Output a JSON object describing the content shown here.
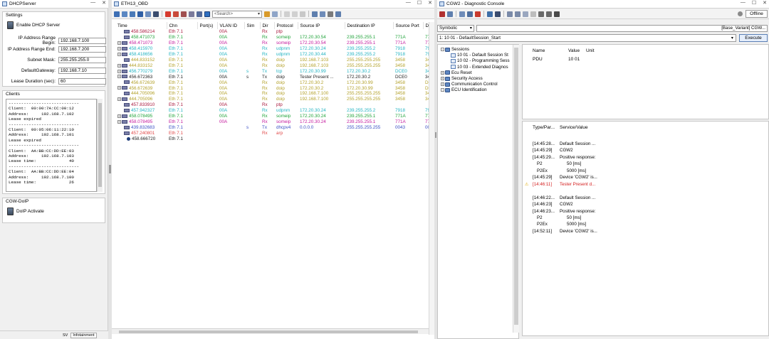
{
  "dhcp": {
    "title": "DHCPServer",
    "settings_label": "Settings",
    "enable_label": "Enable DHCP Server",
    "fields": [
      {
        "label": "IP Address Range Begin:",
        "value": "192.168.7.100"
      },
      {
        "label": "IP Address Range End:",
        "value": "192.168.7.200"
      },
      {
        "label": "Subnet Mask:",
        "value": "255.255.255.0"
      },
      {
        "label": "DefaultGateway:",
        "value": "192.168.7.10"
      },
      {
        "label": "Lease Duration (sec):",
        "value": "60"
      }
    ],
    "clients_label": "Clients",
    "clients_log": "----------------------------\nClient:  00:00:7A:CC:00:12\nAddress:     192.168.7.102\nLease expired\n----------------------------\nClient:  00:05:06:11:22:10\nAddress:     192.168.7.101\nLease expired\n----------------------------\nClient:  AA:BB:CC:DD:EE:03\nAddress:     192.168.7.103\nLease time:             40\n----------------------------\nClient:  AA:BB:CC:DD:EE:04\nAddress:     192.168.7.100\nLease time:             26",
    "doip_label": "CGW-DoIP",
    "doip_activate": "DoIP Activate",
    "bottom_tabs": [
      "SV",
      "Infotainment"
    ]
  },
  "trace": {
    "title": "ETH13_OBD",
    "search_placeholder": "<Search>",
    "columns": [
      "Time",
      "Chn",
      "Port(s)",
      "VLAN ID",
      "Sim",
      "Dir",
      "Protocol",
      "Source IP",
      "Destination IP",
      "Source Port",
      "Destination"
    ],
    "rows": [
      {
        "exp": "",
        "time": "458.586214",
        "chn": "Eth 7.1",
        "port": "",
        "vlan": "00A",
        "sim": "",
        "dir": "Rx",
        "proto": "ptp",
        "src": "",
        "dst": "",
        "sport": "",
        "dport": "",
        "color": "#a8183c"
      },
      {
        "exp": "",
        "time": "458.471073",
        "chn": "Eth 7.1",
        "port": "",
        "vlan": "00A",
        "sim": "",
        "dir": "Rx",
        "proto": "someip",
        "src": "172.20.30.54",
        "dst": "239.255.255.1",
        "sport": "771A",
        "dport": "771A",
        "color": "#20a33a"
      },
      {
        "exp": "+",
        "time": "458.471073",
        "chn": "Eth 7.1",
        "port": "",
        "vlan": "00A",
        "sim": "",
        "dir": "Rx",
        "proto": "someip",
        "src": "172.20.30.54",
        "dst": "239.255.255.1",
        "sport": "771A",
        "dport": "771A",
        "color": "#c41a9e"
      },
      {
        "exp": "+",
        "time": "458.415970",
        "chn": "Eth 7.1",
        "port": "",
        "vlan": "00A",
        "sim": "",
        "dir": "Rx",
        "proto": "udpnm",
        "src": "172.20.30.24",
        "dst": "239.255.255.2",
        "sport": "7918",
        "dport": "7918",
        "color": "#22b3c2"
      },
      {
        "exp": "+",
        "time": "458.418656",
        "chn": "Eth 7.1",
        "port": "",
        "vlan": "00A",
        "sim": "",
        "dir": "Rx",
        "proto": "udpnm",
        "src": "172.20.30.44",
        "dst": "239.255.255.2",
        "sport": "7918",
        "dport": "7918",
        "color": "#22b3c2"
      },
      {
        "exp": "",
        "time": "444.833152",
        "chn": "Eth 7.1",
        "port": "",
        "vlan": "00A",
        "sim": "",
        "dir": "Rx",
        "proto": "doip",
        "src": "192.168.7.103",
        "dst": "255.255.255.255",
        "sport": "3458",
        "dport": "3458",
        "color": "#b3a12a"
      },
      {
        "exp": "+",
        "time": "444.833152",
        "chn": "Eth 7.1",
        "port": "",
        "vlan": "00A",
        "sim": "",
        "dir": "Rx",
        "proto": "doip",
        "src": "192.168.7.103",
        "dst": "255.255.255.255",
        "sport": "3458",
        "dport": "3458",
        "color": "#b3a12a"
      },
      {
        "exp": "+",
        "time": "456.770279",
        "chn": "Eth 7.1",
        "port": "",
        "vlan": "00A",
        "sim": "s",
        "dir": "Tx",
        "proto": "tcp",
        "src": "172.20.30.99",
        "dst": "172.20.30.2",
        "sport": "DCE0",
        "dport": "3458",
        "color": "#22b3c2"
      },
      {
        "exp": "+",
        "time": "456.672363",
        "chn": "Eth 7.1",
        "port": "",
        "vlan": "00A",
        "sim": "s",
        "dir": "Tx",
        "proto": "doip",
        "src": "Tester Present ...",
        "dst": "172.20.30.2",
        "sport": "DCE0",
        "dport": "3458",
        "color": "#222222"
      },
      {
        "exp": "",
        "time": "456.672639",
        "chn": "Eth 7.1",
        "port": "",
        "vlan": "00A",
        "sim": "",
        "dir": "Rx",
        "proto": "doip",
        "src": "172.20.30.2",
        "dst": "172.20.30.99",
        "sport": "3458",
        "dport": "DCE0",
        "color": "#b3a12a"
      },
      {
        "exp": "+",
        "time": "456.672639",
        "chn": "Eth 7.1",
        "port": "",
        "vlan": "00A",
        "sim": "",
        "dir": "Rx",
        "proto": "doip",
        "src": "172.20.30.2",
        "dst": "172.20.30.99",
        "sport": "3458",
        "dport": "DCE0",
        "color": "#b3a12a"
      },
      {
        "exp": "",
        "time": "444.705096",
        "chn": "Eth 7.1",
        "port": "",
        "vlan": "00A",
        "sim": "",
        "dir": "Rx",
        "proto": "doip",
        "src": "192.168.7.100",
        "dst": "255.255.255.255",
        "sport": "3458",
        "dport": "3458",
        "color": "#b3a12a"
      },
      {
        "exp": "+",
        "time": "444.705096",
        "chn": "Eth 7.1",
        "port": "",
        "vlan": "00A",
        "sim": "",
        "dir": "Rx",
        "proto": "doip",
        "src": "192.168.7.100",
        "dst": "255.255.255.255",
        "sport": "3458",
        "dport": "3458",
        "color": "#b3a12a"
      },
      {
        "exp": "",
        "time": "457.833910",
        "chn": "Eth 7.1",
        "port": "",
        "vlan": "00A",
        "sim": "",
        "dir": "Rx",
        "proto": "ptp",
        "src": "",
        "dst": "",
        "sport": "",
        "dport": "",
        "color": "#a8183c"
      },
      {
        "exp": "",
        "time": "457.942327",
        "chn": "Eth 7.1",
        "port": "",
        "vlan": "00A",
        "sim": "",
        "dir": "Rx",
        "proto": "udpnm",
        "src": "172.20.30.24",
        "dst": "239.255.255.2",
        "sport": "7918",
        "dport": "7918",
        "color": "#22b3c2"
      },
      {
        "exp": "+",
        "time": "458.078495",
        "chn": "Eth 7.1",
        "port": "",
        "vlan": "00A",
        "sim": "",
        "dir": "Rx",
        "proto": "someip",
        "src": "172.20.30.24",
        "dst": "239.255.255.1",
        "sport": "771A",
        "dport": "771A",
        "color": "#20a33a"
      },
      {
        "exp": "+",
        "time": "458.078495",
        "chn": "Eth 7.1",
        "port": "",
        "vlan": "00A",
        "sim": "",
        "dir": "Rx",
        "proto": "someip",
        "src": "172.20.30.24",
        "dst": "239.255.255.1",
        "sport": "771A",
        "dport": "771A",
        "color": "#c41a9e"
      },
      {
        "exp": "",
        "time": "439.832683",
        "chn": "Eth 7.1",
        "port": "",
        "vlan": "",
        "sim": "s",
        "dir": "Tx",
        "proto": "dhcpv4",
        "src": "0.0.0.0",
        "dst": "255.255.255.255",
        "sport": "0043",
        "dport": "0044",
        "color": "#3b4fc4"
      },
      {
        "exp": "",
        "time": "457.240801",
        "chn": "Eth 7.1",
        "port": "",
        "vlan": "",
        "sim": "",
        "dir": "Rx",
        "proto": "arp",
        "src": "",
        "dst": "",
        "sport": "",
        "dport": "",
        "color": "#e04848"
      },
      {
        "exp": "i",
        "time": "458.666720",
        "chn": "Eth 7.1",
        "port": "",
        "vlan": "",
        "sim": "",
        "dir": "",
        "proto": "",
        "src": "",
        "dst": "",
        "sport": "",
        "dport": "",
        "color": "#222222"
      }
    ]
  },
  "diag": {
    "title": "CGW2 - Diagnostic Console",
    "offline_label": "Offline",
    "mode_select": "Symbolic",
    "variant_label": "[Base_Variant] CGW...",
    "service_select": "1: 10 01 - DefaultSession_Start",
    "execute_label": "Execute",
    "tree": [
      {
        "level": 0,
        "exp": "-",
        "label": "Sessions"
      },
      {
        "level": 1,
        "exp": "",
        "label": "10 01 - Default Session St"
      },
      {
        "level": 1,
        "exp": "",
        "label": "10 02 - Programming Sess"
      },
      {
        "level": 1,
        "exp": "",
        "label": "10 03 - Extended Diagnos"
      },
      {
        "level": 0,
        "exp": "+",
        "label": "Ecu Reset"
      },
      {
        "level": 0,
        "exp": "+",
        "label": "Security Access"
      },
      {
        "level": 0,
        "exp": "+",
        "label": "Communication Control"
      },
      {
        "level": 0,
        "exp": "-",
        "label": "ECU Identification"
      }
    ],
    "param_headers": [
      "Name",
      "Value",
      "Unit"
    ],
    "param_rows": [
      {
        "name": "PDU",
        "value": "10 01",
        "unit": ""
      }
    ],
    "result_headers": [
      "Type/Par...",
      "Service/Value"
    ],
    "results": [
      {
        "type": "[14:45:28...",
        "value": "Default Session ...",
        "warn": false
      },
      {
        "type": "[14:45:29]",
        "value": "CGW2",
        "warn": false
      },
      {
        "type": "[14:45:29...",
        "value": "Positive response:",
        "warn": false
      },
      {
        "type": "P2",
        "value": "50 [ms]",
        "warn": false,
        "indent": true
      },
      {
        "type": "P2Ex",
        "value": "5000 [ms]",
        "warn": false,
        "indent": true
      },
      {
        "type": "[14:45:29]",
        "value": "Device 'CGW2' is...",
        "warn": false
      },
      {
        "type": "[14:46:11]",
        "value": "Tester Present d...",
        "warn": true
      },
      {
        "type": "",
        "value": "",
        "warn": false
      },
      {
        "type": "[14:46:22...",
        "value": "Default Session ...",
        "warn": false
      },
      {
        "type": "[14:46:23]",
        "value": "CGW2",
        "warn": false
      },
      {
        "type": "[14:46:23...",
        "value": "Positive response:",
        "warn": false
      },
      {
        "type": "P2",
        "value": "50 [ms]",
        "warn": false,
        "indent": true
      },
      {
        "type": "P2Ex",
        "value": "5000 [ms]",
        "warn": false,
        "indent": true
      },
      {
        "type": "[14:52:11]",
        "value": "Device 'CGW2' is...",
        "warn": false
      }
    ]
  }
}
